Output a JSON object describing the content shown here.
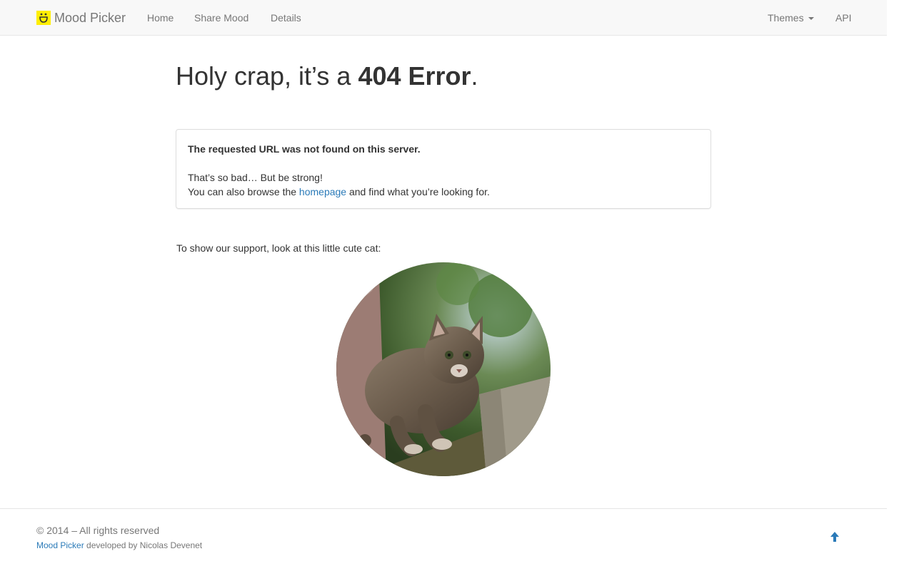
{
  "navbar": {
    "brand": "Mood Picker",
    "logo_icon": "smiley-logo-icon",
    "logo_color": "#ffee00",
    "links": {
      "home": "Home",
      "share": "Share Mood",
      "details": "Details",
      "themes": "Themes",
      "api": "API"
    }
  },
  "main": {
    "title_prefix": "Holy crap, it’s a ",
    "title_strong": "404 Error",
    "title_suffix": ".",
    "alert": {
      "heading": "The requested URL was not found on this server.",
      "line1": "That’s so bad… But be strong!",
      "line2_before": "You can also browse the ",
      "line2_link": "homepage",
      "line2_after": " and find what you’re looking for."
    },
    "support_text": "To show our support, look at this little cute cat:"
  },
  "footer": {
    "copyright": "© 2014 – All rights reserved",
    "project_link": "Mood Picker",
    "developed_by": " developed by Nicolas Devenet",
    "back_to_top_icon": "arrow-up-icon"
  },
  "colors": {
    "link": "#2a7ab8",
    "navbar_bg": "#f8f8f8"
  }
}
